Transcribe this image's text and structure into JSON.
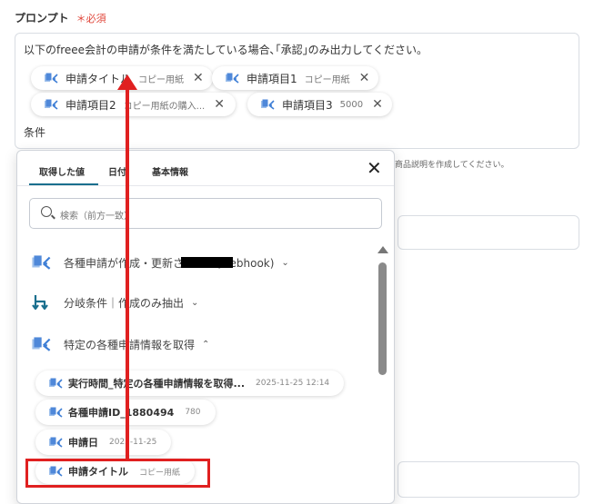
{
  "field": {
    "label": "プロンプト",
    "required": "＊必須",
    "prompt_text": "以下のfreee会計の申請が条件を満たしている場合､｢承認｣のみ出力してください。",
    "chips": [
      {
        "name": "申請タイトル",
        "value": "コピー用紙"
      },
      {
        "name": "申請項目1",
        "value": "コピー用紙"
      },
      {
        "name": "申請項目2",
        "value": "コピー用紙の購入..."
      },
      {
        "name": "申請項目3",
        "value": "5000"
      }
    ],
    "condition_text": "条件",
    "hint": "商品説明を作成してください。"
  },
  "panel": {
    "tabs": [
      "取得した値",
      "日付",
      "基本情報"
    ],
    "search_placeholder": "検索（前方一致）",
    "sections": [
      {
        "label": "各種申請が作成・更新されたら(webhook)",
        "icon": "freee-icon",
        "chevron": "⌄"
      },
      {
        "label": "分岐条件｜作成のみ抽出",
        "icon": "branch-icon",
        "chevron": "⌄"
      },
      {
        "label": "特定の各種申請情報を取得",
        "icon": "freee-icon",
        "chevron": "⌃"
      }
    ],
    "items": [
      {
        "name": "実行時間_特定の各種申請情報を取得...",
        "value": "2025-11-25 12:14"
      },
      {
        "name": "各種申請ID_1880494",
        "value": "780"
      },
      {
        "name": "申請日",
        "value": "2025-11-25"
      },
      {
        "name": "申請タイトル",
        "value": "コピー用紙"
      }
    ]
  },
  "colors": {
    "accent": "#1a6f8e",
    "required": "#e0463a",
    "annotation": "#e02020",
    "icon_blue": "#3f7fd6"
  }
}
